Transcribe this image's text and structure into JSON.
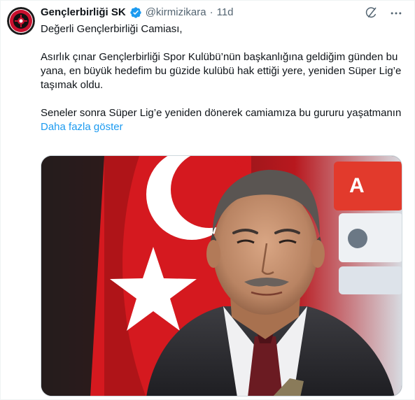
{
  "account": {
    "display_name": "Gençlerbirliği SK",
    "handle": "@kirmizikara",
    "separator": "·",
    "time": "11d"
  },
  "tweet": {
    "line1": "Değerli Gençlerbirliği Camiası,",
    "para2": "Asırlık çınar Gençlerbirliği Spor Kulübü’nün başkanlığına geldiğim günden bu yana, en büyük hedefim bu güzide kulübü hak ettiği yere, yeniden Süper Lig’e taşımak oldu.",
    "para3": "Seneler sonra Süper Lig’e yeniden dönerek camiamıza bu gururu yaşatmanın",
    "show_more": "Daha fazla göster"
  },
  "icons": {
    "verified": "verified-badge-icon",
    "grok": "grok-icon",
    "more": "more-options-icon"
  },
  "colors": {
    "link": "#1d9bf0",
    "verified": "#1d9bf0",
    "text": "#0f1419",
    "muted": "#536471",
    "flag_red": "#d5191f"
  }
}
